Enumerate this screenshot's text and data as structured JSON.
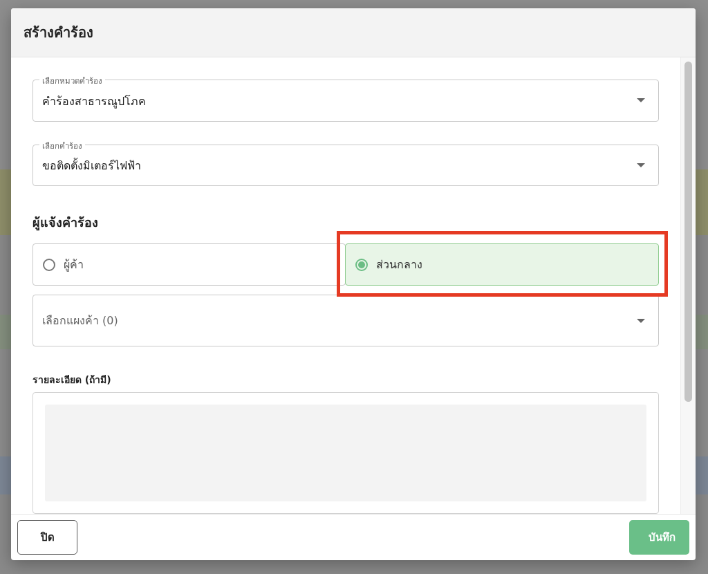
{
  "dialog": {
    "title": "สร้างคำร้อง"
  },
  "category_select": {
    "label": "เลือกหมวดคำร้อง",
    "value": "คำร้องสาธารณูปโภค"
  },
  "request_select": {
    "label": "เลือกคำร้อง",
    "value": "ขอติดตั้งมิเตอร์ไฟฟ้า"
  },
  "reporter": {
    "heading": "ผู้แจ้งคำร้อง",
    "options": [
      {
        "label": "ผู้ค้า",
        "selected": false,
        "highlighted": false
      },
      {
        "label": "ส่วนกลาง",
        "selected": true,
        "highlighted": true
      }
    ]
  },
  "vendor_select": {
    "placeholder": "เลือกแผงค้า (0)"
  },
  "details": {
    "label": "รายละเอียด (ถ้ามี)"
  },
  "buttons": [
    {
      "label": "ปิด",
      "kind": "secondary"
    },
    {
      "label": "บันทึก",
      "kind": "primary"
    }
  ]
}
